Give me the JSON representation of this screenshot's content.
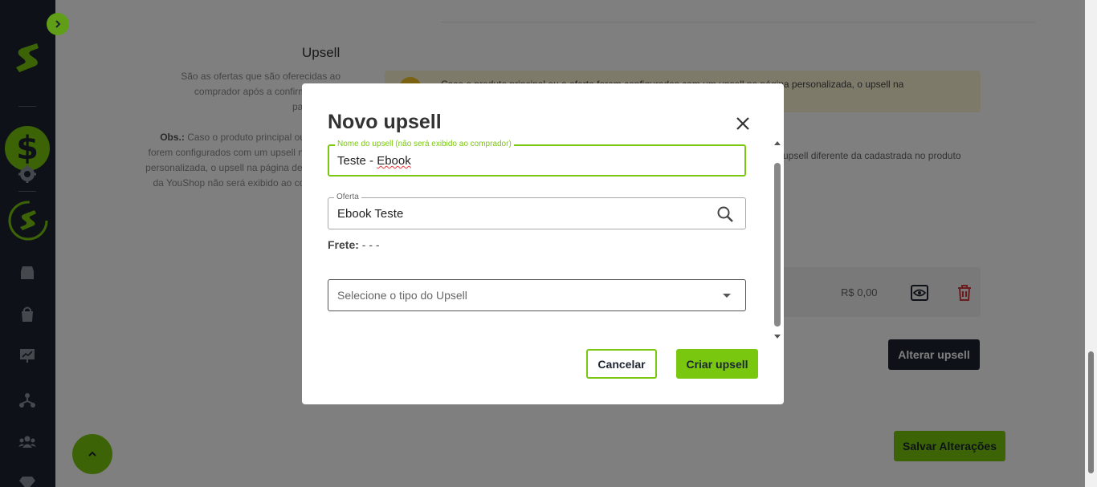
{
  "background": {
    "upsell_title": "Upsell",
    "upsell_description": "São as ofertas que são oferecidas ao comprador após a confirmação do pagamento",
    "obs_label": "Obs.:",
    "obs_text": "Caso o produto principal ou a oferta forem configurados com um upsell na página personalizada, o upsell na página de sucesso da YouShop não será exibido ao comprador",
    "warning_text": "Caso o produto principal ou a oferta forem configurados com um upsell na página personalizada, o upsell na",
    "note_text": "upsell diferente da cadastrada no produto",
    "row_price": "R$ 0,00",
    "alterar_label": "Alterar upsell",
    "salvar_label": "Salvar Alterações"
  },
  "modal": {
    "title": "Novo upsell",
    "name_field": {
      "label": "Nome do upsell (não será exibido ao comprador)",
      "value_prefix": "Teste - ",
      "value_misspelled": "Ebook"
    },
    "offer_field": {
      "label": "Oferta",
      "value": "Ebook Teste"
    },
    "frete": {
      "label": "Frete:",
      "value": "- - -"
    },
    "type_select": {
      "placeholder": "Selecione o tipo do Upsell"
    },
    "cancel_label": "Cancelar",
    "create_label": "Criar upsell"
  },
  "colors": {
    "brand_green": "#79c80f",
    "sidebar_dark": "#1c2531",
    "danger_red": "#d9363e"
  }
}
